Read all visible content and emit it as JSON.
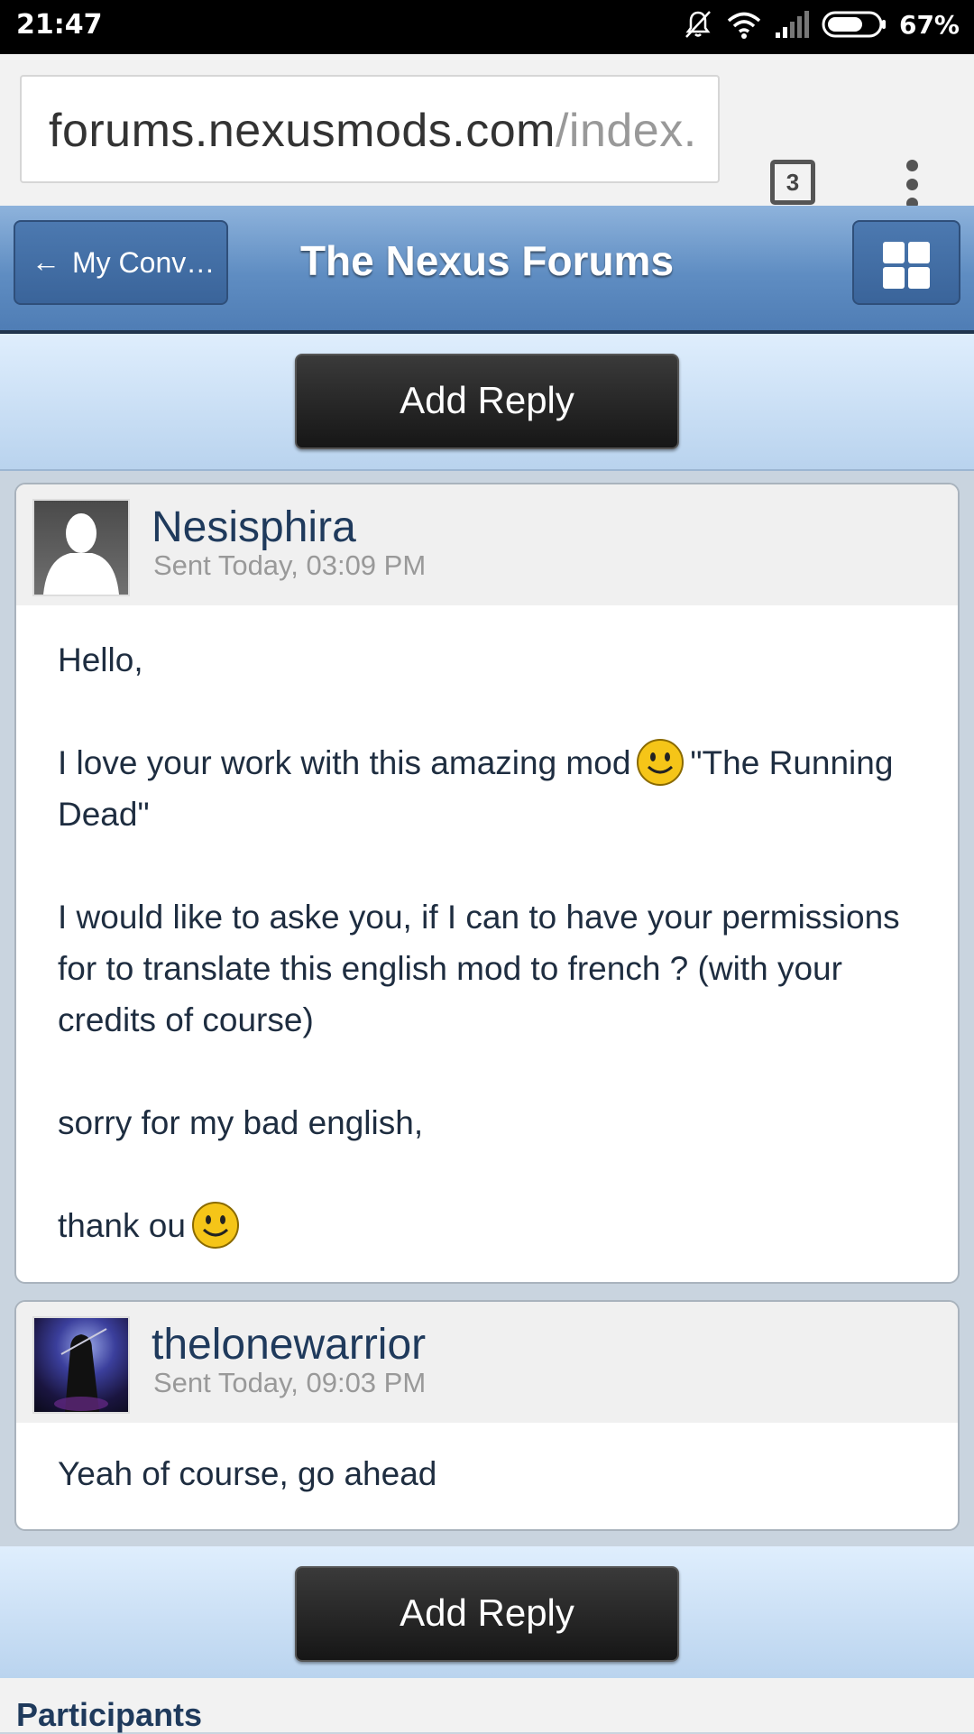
{
  "status_bar": {
    "time": "21:47",
    "battery": "67%"
  },
  "browser": {
    "url_host": "forums.nexusmods.com",
    "url_path": "/index.",
    "tab_count": "3"
  },
  "header": {
    "back_label": "My Conv…",
    "title": "The Nexus Forums"
  },
  "reply_label": "Add Reply",
  "posts": [
    {
      "username": "Nesisphira",
      "sent": "Sent Today, 03:09 PM",
      "greeting": "Hello,",
      "p1_before": "I love your work with this amazing mod",
      "p1_after": "\"The Running Dead\"",
      "p2": "I would like to aske you, if I can to have your permissions for to translate this english mod to french ? (with your credits of course)",
      "p3": "sorry for my bad english,",
      "p4": "thank ou"
    },
    {
      "username": "thelonewarrior",
      "sent": "Sent Today, 09:03 PM",
      "text": "Yeah of course, go ahead"
    }
  ],
  "participants_heading": "Participants",
  "colors": {
    "header_blue": "#5f8dc2",
    "username_navy": "#1f3a5c",
    "button_dark": "#1e1e1e"
  }
}
